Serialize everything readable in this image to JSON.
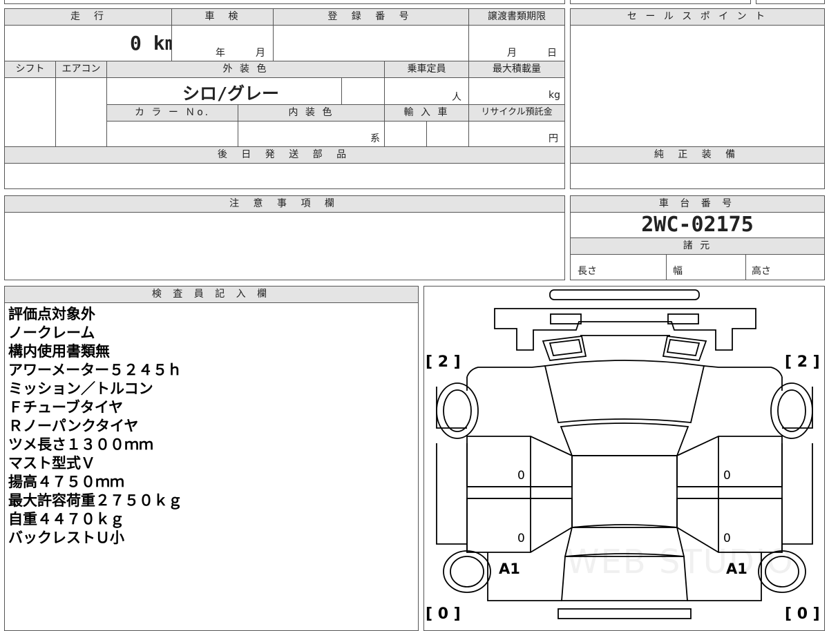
{
  "vehicle_info": {
    "mileage_label": "走　行",
    "mileage_value": "0 km",
    "inspection_label": "車　検",
    "inspection_year_unit": "年",
    "inspection_month_unit": "月",
    "registration_label": "登 録 番 号",
    "transfer_deadline_label": "譲渡書類期限",
    "transfer_month_unit": "月",
    "transfer_day_unit": "日",
    "shift_label": "シフト",
    "aircon_label": "エアコン",
    "exterior_color_label": "外 装 色",
    "exterior_color_value": "シロ/グレー",
    "capacity_label": "乗車定員",
    "capacity_unit": "人",
    "max_load_label": "最大積載量",
    "max_load_unit": "kg",
    "color_no_label": "カ ラ ー Ｎo.",
    "interior_color_label": "内 装 色",
    "interior_color_unit": "系",
    "import_label": "輸 入 車",
    "recycle_label": "リサイクル預託金",
    "recycle_unit": "円"
  },
  "sales_point": {
    "label": "セ ー ル ス ポ イ ン ト"
  },
  "later_parts": {
    "label": "後 日 発 送 部 品"
  },
  "genuine_equipment": {
    "label": "純 正 装 備"
  },
  "caution": {
    "label": "注 意 事 項 欄"
  },
  "chassis": {
    "label": "車 台 番 号",
    "number": "2WC-02175",
    "specs_label": "諸 元",
    "length_label": "長さ",
    "width_label": "幅",
    "height_label": "高さ"
  },
  "inspector": {
    "label": "検 査 員 記 入 欄",
    "lines": [
      "評価点対象外",
      "ノークレーム",
      "構内使用書類無",
      "アワーメーター５２４５ｈ",
      "ミッション／トルコン",
      "Ｆチューブタイヤ",
      "Ｒノーパンクタイヤ",
      "ツメ長さ１３００ｍｍ",
      "マスト型式Ｖ",
      "揚高４７５０ｍｍ",
      "最大許容荷重２７５０ｋｇ",
      "自重４４７０ｋｇ",
      "バックレストＵ小"
    ]
  },
  "diagram": {
    "front_left_bracket": "[ 2 ]",
    "front_right_bracket": "[ 2 ]",
    "rear_left_bracket": "[ 0 ]",
    "rear_right_bracket": "[ 0 ]",
    "left_door_front": "0",
    "left_door_rear": "0",
    "right_door_front": "0",
    "right_door_rear": "0",
    "left_rear_mark": "A1",
    "right_rear_mark": "A1",
    "watermark": "WEB STUDIO"
  }
}
